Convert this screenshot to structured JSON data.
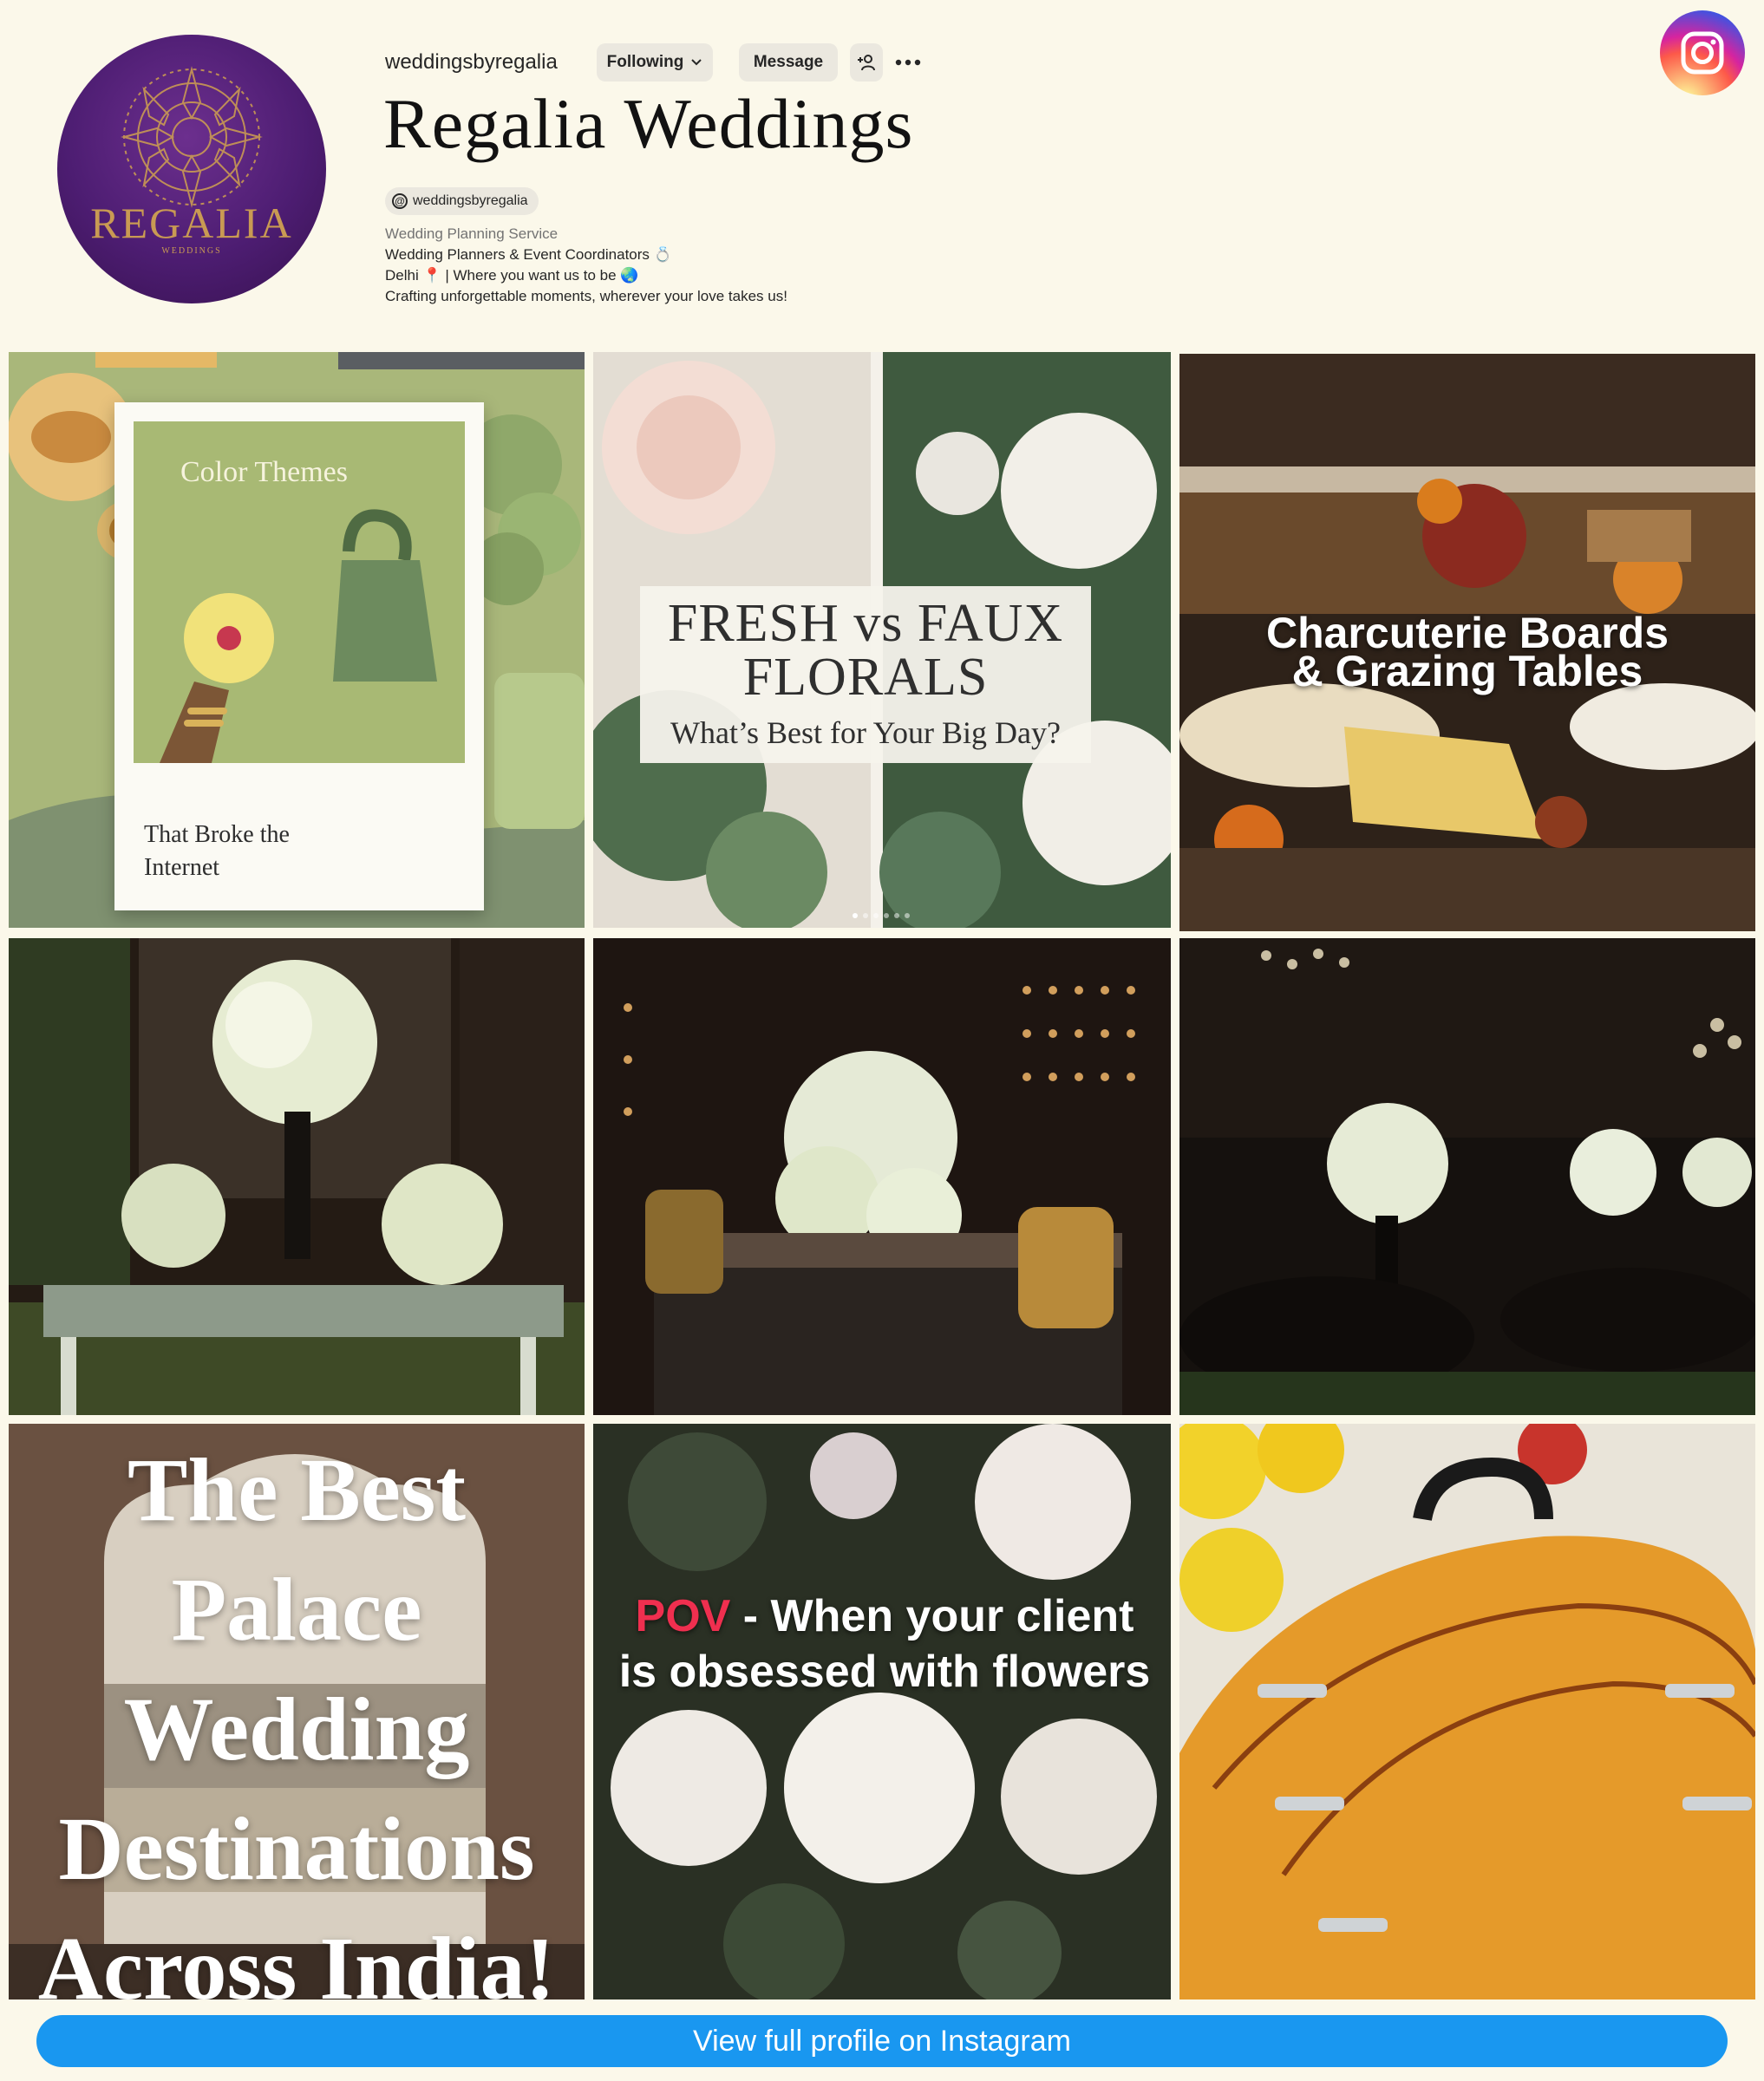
{
  "profile": {
    "username": "weddingsbyregalia",
    "name": "Regalia Weddings",
    "threads_handle": "weddingsbyregalia",
    "avatar": {
      "logo_word": "REGALIA",
      "logo_sub": "WEDDINGS"
    },
    "bio": {
      "category": "Wedding Planning Service",
      "line1": "Wedding Planners & Event Coordinators 💍",
      "line2": "Delhi 📍 | Where you want us to be 🌏",
      "line3": "Crafting unforgettable moments, wherever your love takes us!"
    }
  },
  "actions": {
    "following_label": "Following",
    "message_label": "Message",
    "suggest_icon": "add-person-icon",
    "more_icon": "more-horizontal-icon"
  },
  "posts": {
    "p1": {
      "title": "Color Themes",
      "subtitle_l1": "That Broke the",
      "subtitle_l2": "Internet"
    },
    "p2": {
      "line1": "FRESH vs FAUX",
      "line2": "FLORALS",
      "line3": "What’s Best for Your Big Day?"
    },
    "p3": {
      "line1": "Charcuterie Boards",
      "line2": "& Grazing Tables"
    },
    "p4": {
      "icon": "floral-centerpiece-photo"
    },
    "p5": {
      "icon": "floral-arrangement-photo"
    },
    "p6": {
      "icon": "banquet-tables-photo"
    },
    "p7": {
      "l1": "The Best",
      "l2": "Palace",
      "l3": "Wedding",
      "l4": "Destinations",
      "l5": "Across India!"
    },
    "p8": {
      "pov": "POV",
      "rest_l1": " - When your client",
      "rest_l2": "is obsessed with flowers"
    },
    "p9": {
      "icon": "dholak-drum-photo"
    }
  },
  "footer": {
    "view_profile_label": "View full profile on Instagram"
  },
  "colors": {
    "page_bg": "#fbf8ea",
    "accent_blue": "#1997f0",
    "avatar_purple": "#4d1d72",
    "pov_red": "#ef2f4f"
  }
}
